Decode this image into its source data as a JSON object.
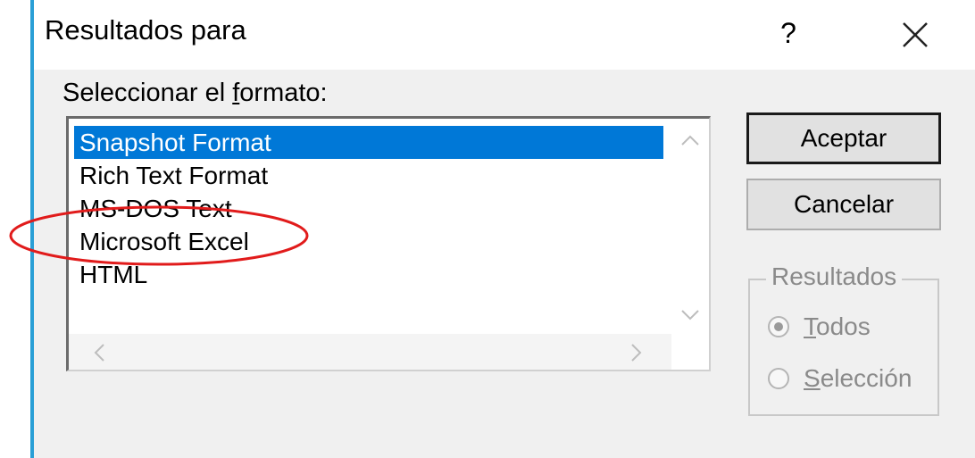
{
  "dialog": {
    "title": "Resultados para",
    "help_label": "?"
  },
  "format_section": {
    "label_before": "Seleccionar el ",
    "label_mnemonic": "f",
    "label_after": "ormato:",
    "items": [
      {
        "label": "Snapshot Format",
        "selected": true
      },
      {
        "label": "Rich Text Format",
        "selected": false
      },
      {
        "label": "MS-DOS Text",
        "selected": false
      },
      {
        "label": "Microsoft Excel",
        "selected": false,
        "circled": true
      },
      {
        "label": "HTML",
        "selected": false
      }
    ]
  },
  "buttons": {
    "ok_label": "Aceptar",
    "cancel_label": "Cancelar"
  },
  "results_group": {
    "title": "Resultados",
    "options": [
      {
        "mnemonic": "T",
        "rest": "odos",
        "checked": true
      },
      {
        "mnemonic": "S",
        "rest": "elección",
        "checked": false
      }
    ]
  },
  "colors": {
    "selection": "#0078d7",
    "annotation": "#e11b1b",
    "accent": "#2a9fd6"
  },
  "icons": {
    "close": "close-icon",
    "scroll_up": "chevron-up-icon",
    "scroll_down": "chevron-down-icon",
    "scroll_left": "chevron-left-icon",
    "scroll_right": "chevron-right-icon"
  }
}
